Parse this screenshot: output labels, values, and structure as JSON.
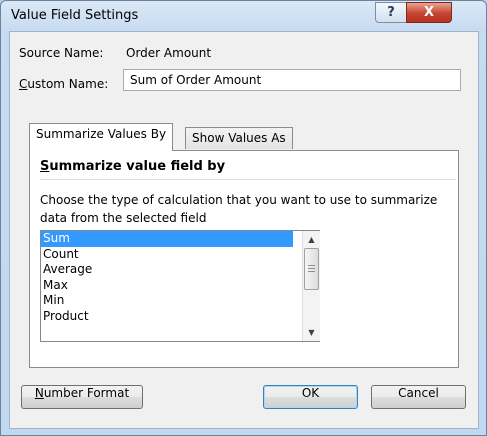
{
  "window": {
    "title": "Value Field Settings",
    "help_glyph": "?",
    "close_glyph": "X"
  },
  "source": {
    "label": "Source Name:",
    "value": "Order Amount"
  },
  "custom": {
    "label_accel": "C",
    "label_rest": "ustom Name:",
    "value": "Sum of Order Amount"
  },
  "tabs": [
    {
      "label": "Summarize Values By",
      "active": true
    },
    {
      "label": "Show Values As",
      "active": false
    }
  ],
  "summarize": {
    "heading_accel": "S",
    "heading_rest": "ummarize value field by",
    "description": "Choose the type of calculation that you want to use to summarize data from the selected field",
    "items": [
      "Sum",
      "Count",
      "Average",
      "Max",
      "Min",
      "Product"
    ],
    "selected": "Sum"
  },
  "buttons": {
    "number_format_accel": "N",
    "number_format_rest": "umber Format",
    "ok": "OK",
    "cancel": "Cancel"
  },
  "colors": {
    "selection": "#3399ff",
    "close_button": "#c7442e"
  },
  "icons": {
    "help": "question-mark-icon",
    "close": "close-icon",
    "scroll_up": "chevron-up-icon",
    "scroll_down": "chevron-down-icon"
  }
}
